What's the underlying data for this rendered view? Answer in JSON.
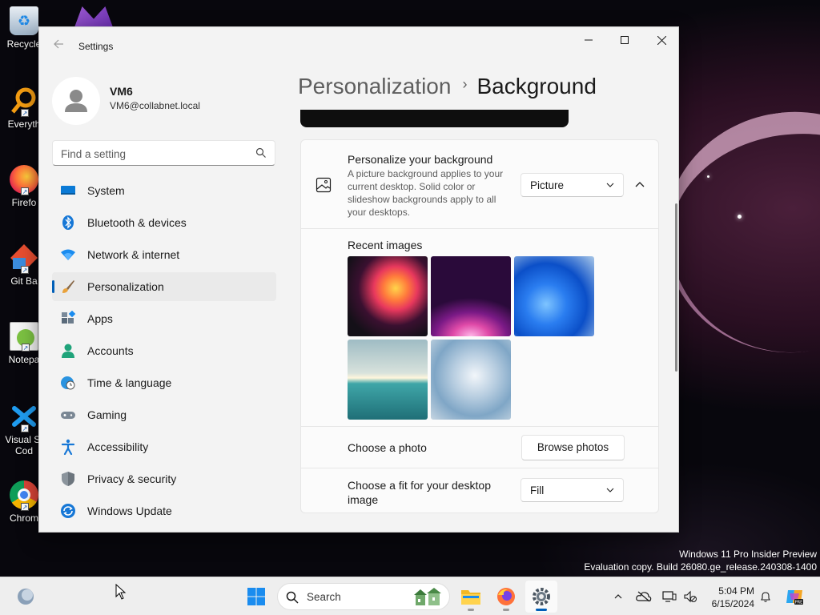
{
  "desktop": {
    "icons": [
      {
        "label": "Recycle",
        "icon": "recycle-bin-icon"
      },
      {
        "label": "Everyth",
        "icon": "everything-search-icon"
      },
      {
        "label": "Firefo",
        "icon": "firefox-icon"
      },
      {
        "label": "Git Ba",
        "icon": "git-bash-icon"
      },
      {
        "label": "Notepa",
        "icon": "notepad-plus-plus-icon"
      },
      {
        "label": "Visual St\nCod",
        "icon": "vscode-icon"
      },
      {
        "label": "Chrom",
        "icon": "chrome-icon"
      }
    ],
    "watermark": {
      "line1": "Windows 11 Pro Insider Preview",
      "line2": "Evaluation copy. Build 26080.ge_release.240308-1400"
    }
  },
  "window": {
    "title": "Settings",
    "profile": {
      "name": "VM6",
      "email": "VM6@collabnet.local"
    },
    "search": {
      "placeholder": "Find a setting"
    },
    "nav": [
      {
        "label": "System",
        "icon": "system-display-icon",
        "active": false
      },
      {
        "label": "Bluetooth & devices",
        "icon": "bluetooth-icon",
        "active": false
      },
      {
        "label": "Network & internet",
        "icon": "wifi-icon",
        "active": false
      },
      {
        "label": "Personalization",
        "icon": "paintbrush-icon",
        "active": true
      },
      {
        "label": "Apps",
        "icon": "apps-icon",
        "active": false
      },
      {
        "label": "Accounts",
        "icon": "person-icon",
        "active": false
      },
      {
        "label": "Time & language",
        "icon": "globe-clock-icon",
        "active": false
      },
      {
        "label": "Gaming",
        "icon": "gamepad-icon",
        "active": false
      },
      {
        "label": "Accessibility",
        "icon": "accessibility-icon",
        "active": false
      },
      {
        "label": "Privacy & security",
        "icon": "shield-icon",
        "active": false
      },
      {
        "label": "Windows Update",
        "icon": "update-sync-icon",
        "active": false
      }
    ],
    "breadcrumb": {
      "parent": "Personalization",
      "separator": "›",
      "current": "Background"
    },
    "background": {
      "title": "Personalize your background",
      "description": "A picture background applies to your current desktop. Solid color or slideshow backgrounds apply to all your desktops.",
      "type_value": "Picture",
      "recent_title": "Recent images",
      "choose_photo_label": "Choose a photo",
      "browse_label": "Browse photos",
      "fit_label": "Choose a fit for your desktop image",
      "fit_value": "Fill"
    }
  },
  "taskbar": {
    "search_label": "Search",
    "time": "5:04 PM",
    "date": "6/15/2024",
    "accent_color": "#005fb8"
  }
}
